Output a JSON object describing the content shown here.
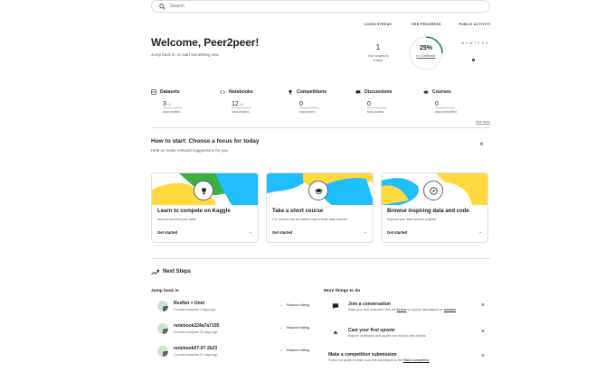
{
  "search": {
    "placeholder": "Search"
  },
  "welcome": {
    "title": "Welcome, Peer2peer!",
    "subtitle": "Jump back in, or start something new."
  },
  "login_streak": {
    "label": "LOGIN STREAK",
    "value": "1",
    "note_line1": "Your longest is",
    "note_line2": "6 days"
  },
  "tier_progress": {
    "label": "TIER PROGRESS",
    "percent_text": "25%",
    "percent_value": 25,
    "note": "to Contributor",
    "accent": "#20BEFF",
    "track": "#e8eaed",
    "ring_color": "#1e8e3e"
  },
  "public_activity": {
    "label": "PUBLIC ACTIVITY",
    "days": [
      "M",
      "T",
      "W",
      "T",
      "F",
      "S",
      "S"
    ]
  },
  "stats": [
    {
      "name": "Datasets",
      "value": "3",
      "delta": "+1",
      "sub": "total created",
      "icon": "datasets-icon"
    },
    {
      "name": "Notebooks",
      "value": "12",
      "delta": "+1",
      "sub": "total created",
      "icon": "notebooks-icon"
    },
    {
      "name": "Competitions",
      "value": "0",
      "delta": "",
      "sub": "total joined",
      "icon": "trophy-icon"
    },
    {
      "name": "Discussions",
      "value": "0",
      "delta": "",
      "sub": "total posted",
      "icon": "discussion-icon"
    },
    {
      "name": "Courses",
      "value": "0",
      "delta": "",
      "sub": "total completed",
      "icon": "courses-icon"
    }
  ],
  "hide_icons": "Hide icons",
  "howto": {
    "title": "How to start: Choose a focus for today",
    "subtitle": "Help us make relevant suggestions for you"
  },
  "cards": [
    {
      "title": "Learn to compete on Kaggle",
      "desc": "Improve and test your skills",
      "cta": "Get started",
      "icon": "trophy-icon"
    },
    {
      "title": "Take a short course",
      "desc": "Our courses are the fastest way to learn data science",
      "cta": "Get started",
      "icon": "graduation-cap-icon"
    },
    {
      "title": "Browse inspiring data and code",
      "desc": "Improve your data science projects",
      "cta": "Get started",
      "icon": "compass-icon"
    }
  ],
  "next_steps": {
    "title": "Next Steps"
  },
  "jump_back": {
    "title": "Jump back in",
    "items": [
      {
        "name": "ResNet + Unet",
        "sub": "Commit complete 2 days ago",
        "action": "Resume editing"
      },
      {
        "name": "notebook224a7a7105",
        "sub": "Commit complete 20 days ago",
        "action": "Resume editing"
      },
      {
        "name": "notebook07-07-2k23",
        "sub": "Commit complete 23 days ago",
        "action": "Resume editing"
      }
    ]
  },
  "more_things": {
    "title": "More things to do",
    "items": [
      {
        "name": "Join a conversation",
        "desc_a": "Make your first comment! Visit the ",
        "link_a": "forums",
        "desc_b": " or explore discussions on ",
        "link_b": "datasets",
        "desc_c": "."
      },
      {
        "name": "Cast your first upvote",
        "desc_a": "Explore notebooks and upvote one that you find helpful",
        "link_a": "",
        "desc_b": "",
        "link_b": "",
        "desc_c": ""
      },
      {
        "name": "Make a competition submission",
        "desc_a": "Follow our guide to make your first submission to the ",
        "link_a": "Titanic competition",
        "desc_b": "",
        "link_b": "",
        "desc_c": ""
      }
    ]
  },
  "colors": {
    "yellow": "#FFD93D",
    "blue": "#20BEFF",
    "green": "#3CB043"
  }
}
